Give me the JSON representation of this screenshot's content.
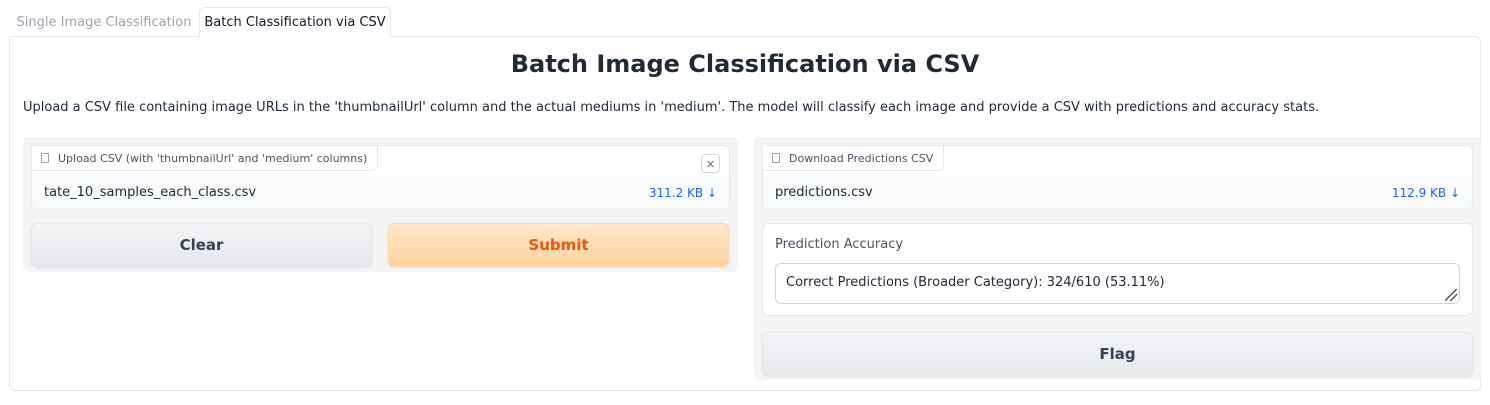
{
  "tabs": [
    {
      "label": "Single Image Classification",
      "active": false
    },
    {
      "label": "Batch Classification via CSV",
      "active": true
    }
  ],
  "main": {
    "title": "Batch Image Classification via CSV",
    "description": "Upload a CSV file containing image URLs in the 'thumbnailUrl' column and the actual mediums in 'medium'. The model will classify each image and provide a CSV with predictions and accuracy stats."
  },
  "upload": {
    "label": "Upload CSV (with 'thumbnailUrl' and 'medium' columns)",
    "file_name": "tate_10_samples_each_class.csv",
    "file_size": "311.2 KB ↓",
    "close_glyph": "×"
  },
  "buttons": {
    "clear": "Clear",
    "submit": "Submit",
    "flag": "Flag"
  },
  "download": {
    "label": "Download Predictions CSV",
    "file_name": "predictions.csv",
    "file_size": "112.9 KB ↓"
  },
  "accuracy": {
    "label": "Prediction Accuracy",
    "value": "Correct Predictions (Broader Category): 324/610 (53.11%)"
  },
  "colors": {
    "accent_orange": "#ea580c",
    "link_blue": "#2563eb"
  }
}
